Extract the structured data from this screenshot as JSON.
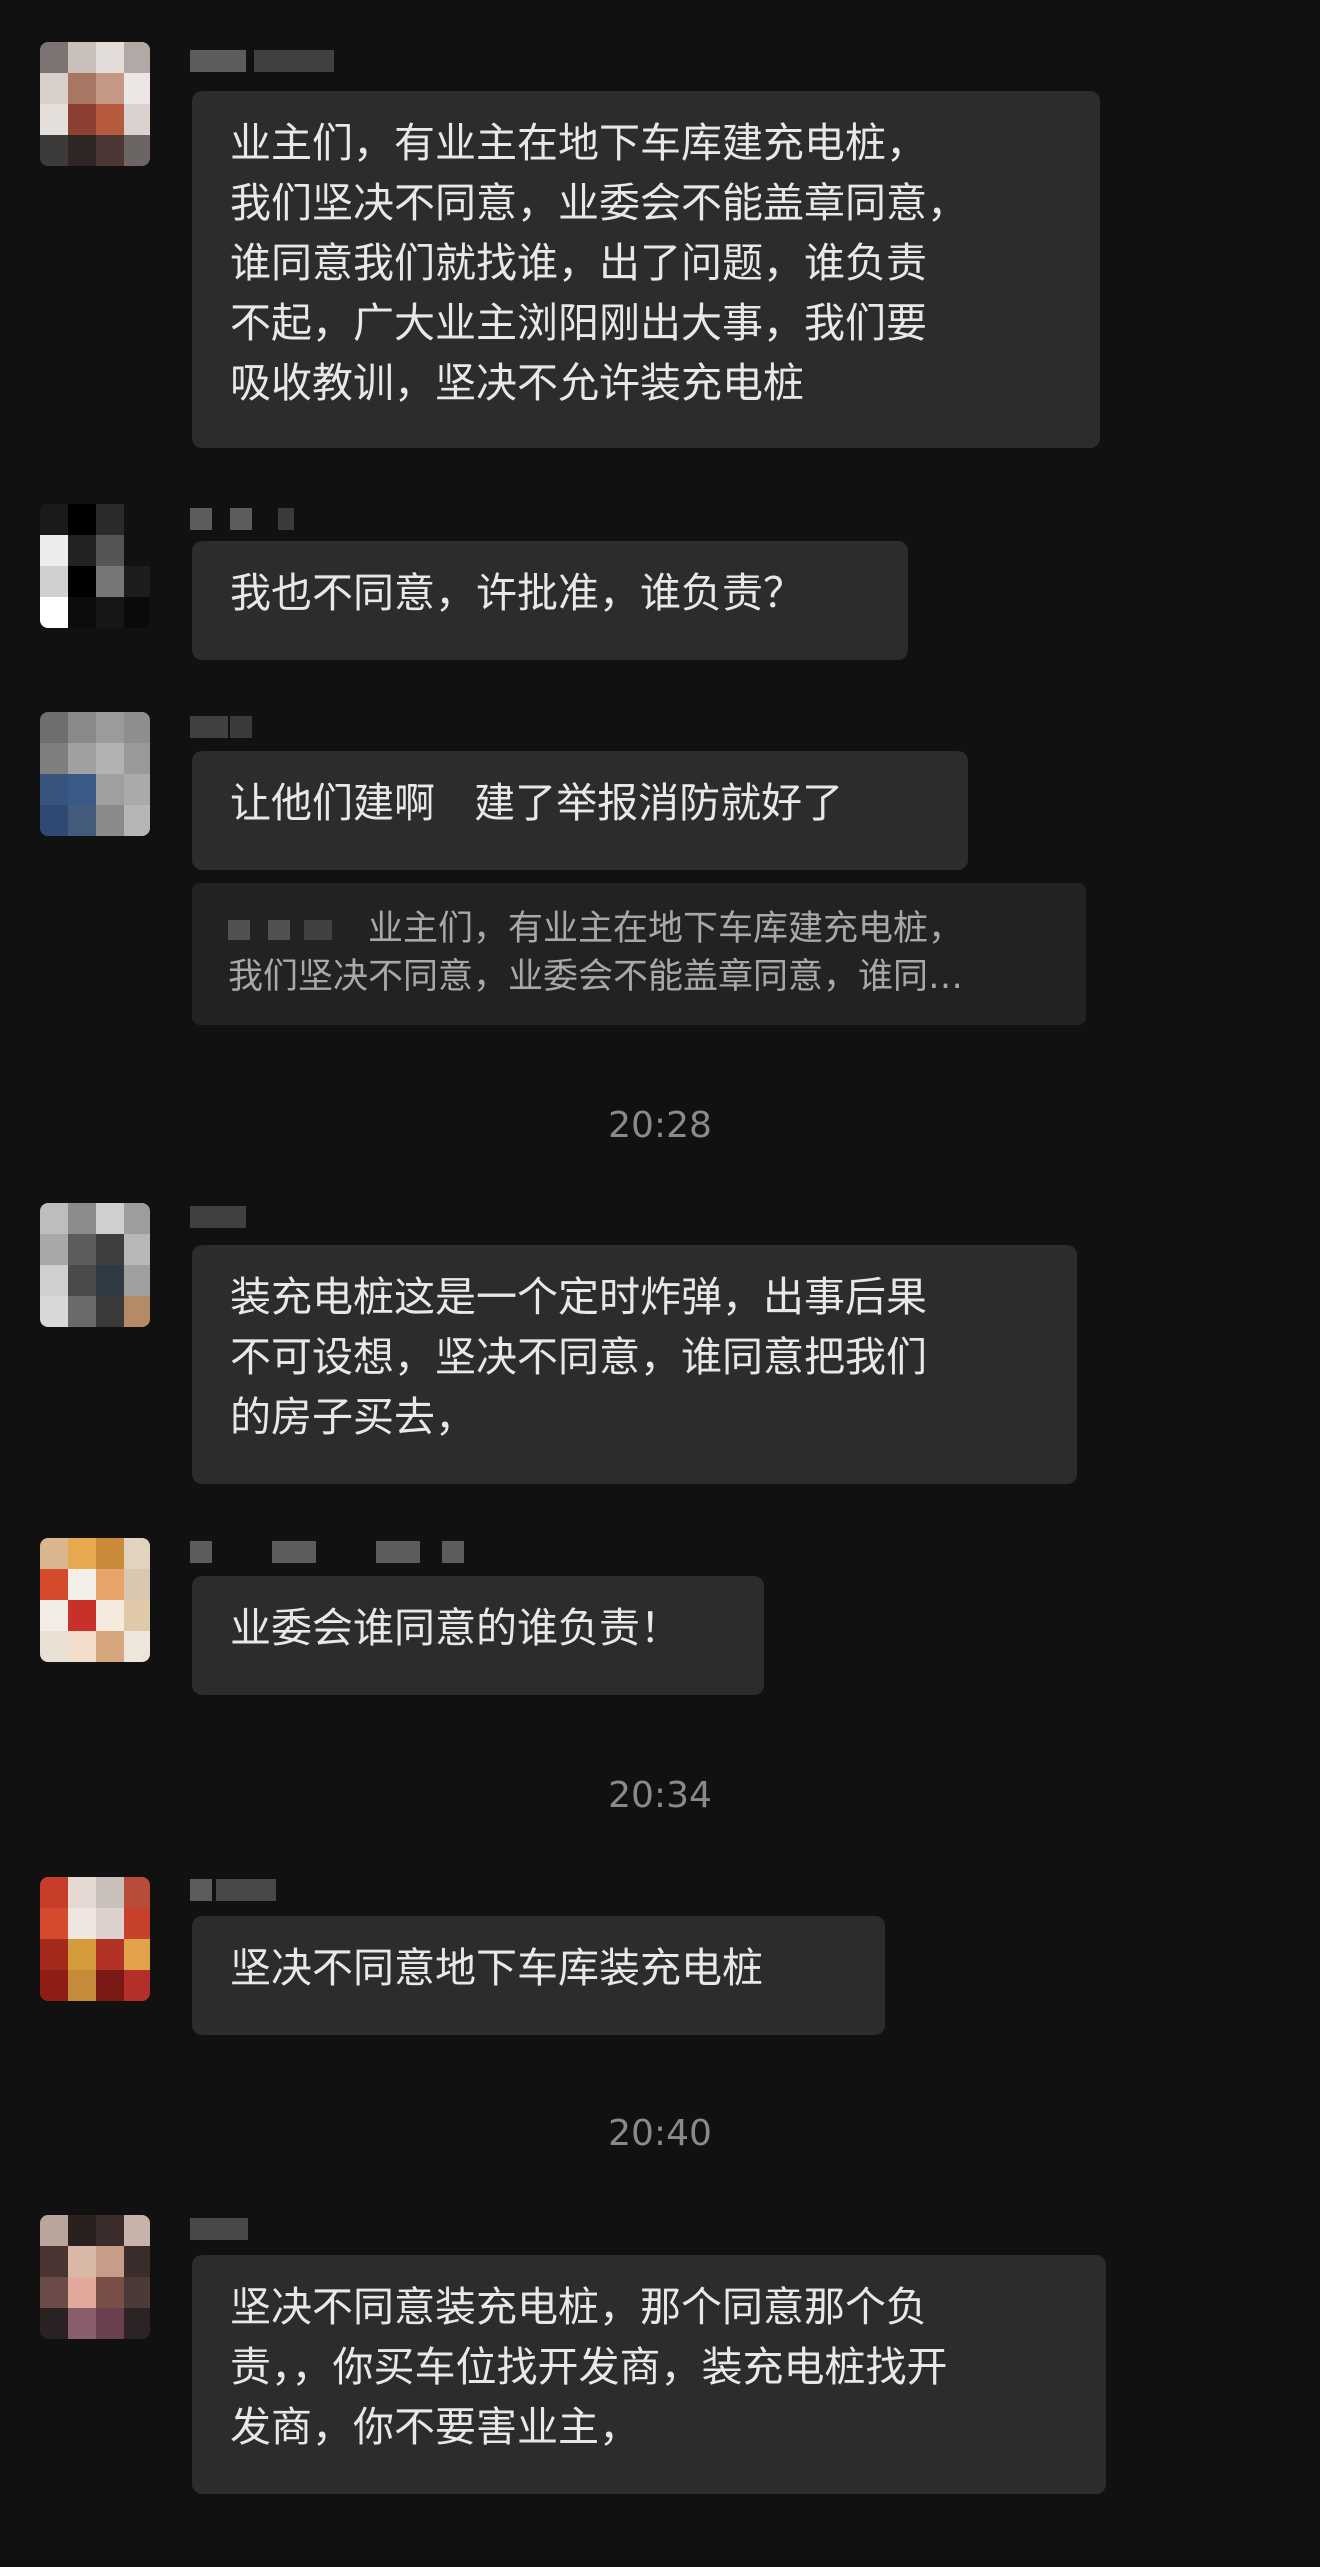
{
  "messages": [
    {
      "text": "业主们，有业主在地下车库建充电桩，\n我们坚决不同意，业委会不能盖章同意，\n谁同意我们就找谁，出了问题，谁负责\n不起，广大业主浏阳刚出大事，我们要\n吸收教训，坚决不允许装充电桩"
    },
    {
      "text": "我也不同意，许批准，谁负责？"
    },
    {
      "text": "让他们建啊   建了举报消防就好了",
      "quote": "业主们，有业主在地下车库建充电桩，\n我们坚决不同意，业委会不能盖章同意，谁同…"
    },
    {
      "text": "装充电桩这是一个定时炸弹，出事后果\n不可设想，坚决不同意，谁同意把我们\n的房子买去，"
    },
    {
      "text": "业委会谁同意的谁负责！"
    },
    {
      "text": "坚决不同意地下车库装充电桩"
    },
    {
      "text": "坚决不同意装充电桩，那个同意那个负\n责，，你买车位找开发商，装充电桩找开\n发商，你不要害业主，"
    }
  ],
  "timestamps": [
    "20:28",
    "20:34",
    "20:40"
  ],
  "colors": {
    "background": "#111111",
    "bubble": "#2c2c2c",
    "quote": "#222222",
    "text": "#e8e8e8",
    "timestamp": "#8a8a8a"
  }
}
